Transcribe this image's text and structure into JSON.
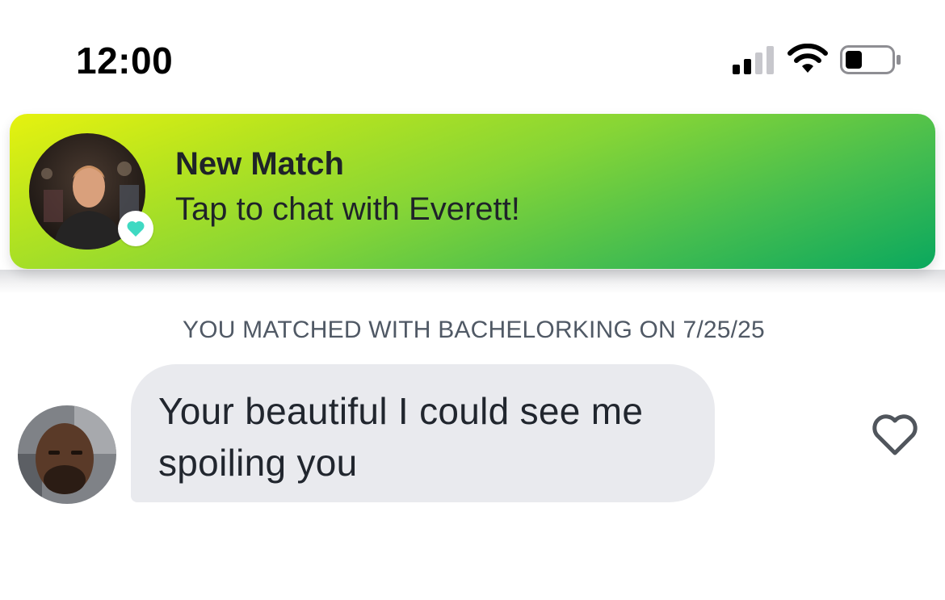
{
  "status_bar": {
    "time": "12:00",
    "icons": [
      "cellular-signal-icon",
      "wifi-icon",
      "battery-icon"
    ]
  },
  "notification": {
    "title": "New Match",
    "subtitle": "Tap to chat with Everett!",
    "avatar": "match-avatar",
    "badge_icon": "heart-icon",
    "badge_color": "#3fd9c2",
    "gradient_start": "#e6f20f",
    "gradient_end": "#0aa85e"
  },
  "chat": {
    "matched_label": "YOU MATCHED WITH BACHELORKING ON 7/25/25",
    "messages": [
      {
        "text": "Your beautiful I could see me spoiling you",
        "sender_avatar": "sender-avatar",
        "like_icon": "heart-outline-icon"
      }
    ]
  },
  "colors": {
    "bubble": "#e9eaee",
    "text": "#21262e",
    "meta_text": "#505965"
  }
}
